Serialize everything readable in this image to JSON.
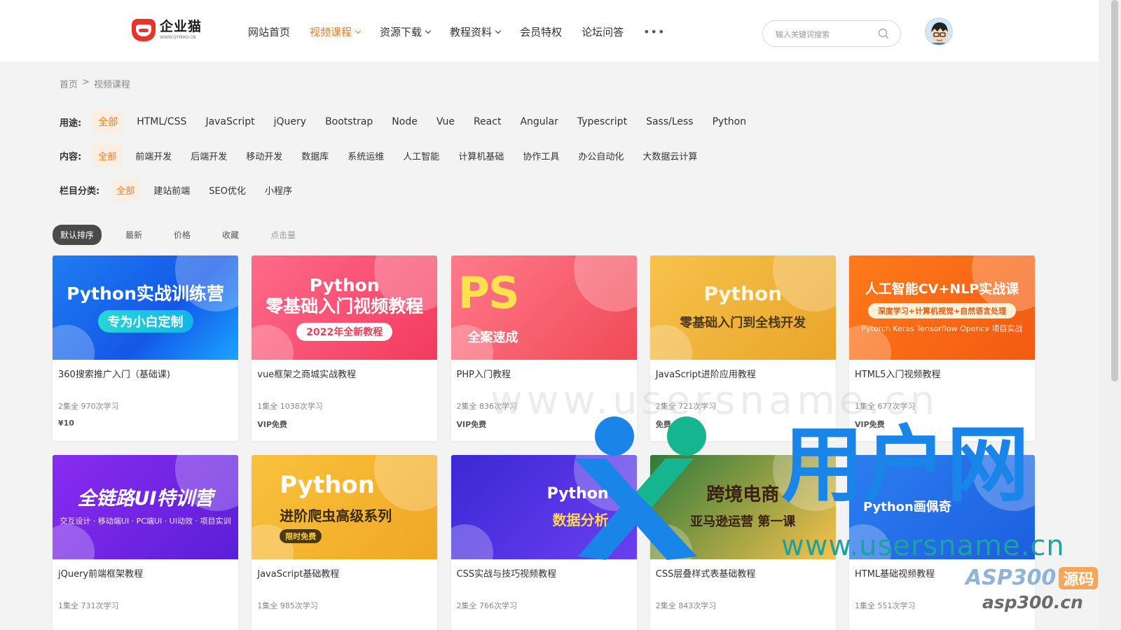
{
  "header": {
    "logo_name": "企业猫",
    "logo_url": "WWW.QYMAO.CN",
    "nav": [
      {
        "label": "网站首页",
        "dropdown": false,
        "active": false
      },
      {
        "label": "视频课程",
        "dropdown": true,
        "active": true
      },
      {
        "label": "资源下载",
        "dropdown": true,
        "active": false
      },
      {
        "label": "教程资料",
        "dropdown": true,
        "active": false
      },
      {
        "label": "会员特权",
        "dropdown": false,
        "active": false
      },
      {
        "label": "论坛问答",
        "dropdown": false,
        "active": false
      }
    ],
    "more": "•••",
    "search_placeholder": "输入关键词搜索"
  },
  "breadcrumb": {
    "home": "首页",
    "sep": ">",
    "current": "视频课程"
  },
  "filters": {
    "usage": {
      "label": "用途:",
      "options": [
        "全部",
        "HTML/CSS",
        "JavaScript",
        "jQuery",
        "Bootstrap",
        "Node",
        "Vue",
        "React",
        "Angular",
        "Typescript",
        "Sass/Less",
        "Python"
      ]
    },
    "content": {
      "label": "内容:",
      "options": [
        "全部",
        "前端开发",
        "后端开发",
        "移动开发",
        "数据库",
        "系统运维",
        "人工智能",
        "计算机基础",
        "协作工具",
        "办公自动化",
        "大数据云计算"
      ]
    },
    "category": {
      "label": "栏目分类:",
      "options": [
        "全部",
        "建站前端",
        "SEO优化",
        "小程序"
      ]
    }
  },
  "sort": [
    "默认排序",
    "最新",
    "价格",
    "收藏",
    "点击量"
  ],
  "cards": [
    {
      "thumb_t1": "Python实战训练营",
      "thumb_t2": "专为小白定制",
      "thumb_t3": "",
      "title": "360搜索推广入门（基础课)",
      "meta": "2集全 970次学习",
      "price": "¥10"
    },
    {
      "thumb_t1": "Python\n零基础入门视频教程",
      "thumb_t2": "2022年全新教程",
      "thumb_t3": "",
      "title": "vue框架之商城实战教程",
      "meta": "1集全 1038次学习",
      "price": "VIP免费"
    },
    {
      "thumb_t1": "PS",
      "thumb_t2": "全案速成",
      "thumb_t3": "",
      "title": "PHP入门教程",
      "meta": "2集全 836次学习",
      "price": "VIP免费"
    },
    {
      "thumb_t1": "Python",
      "thumb_t2": "零基础入门到全栈开发",
      "thumb_t3": "",
      "title": "JavaScript进阶应用教程",
      "meta": "2集全 721次学习",
      "price": "免费"
    },
    {
      "thumb_t1": "人工智能CV+NLP实战课",
      "thumb_t2": "深度学习+计算机视觉+自然语言处理",
      "thumb_t3": "Pytorch Keras Tensorflow Opencv 项目实战",
      "title": "HTML5入门视频教程",
      "meta": "1集全 677次学习",
      "price": "VIP免费"
    },
    {
      "thumb_t1": "全链路UI特训营",
      "thumb_t2": "",
      "thumb_t3": "交互设计 · 移动端UI · PC端UI · UI动效 · 项目实训",
      "title": "jQuery前端框架教程",
      "meta": "1集全 731次学习",
      "price": ""
    },
    {
      "thumb_t1": "Python",
      "thumb_t2": "进阶爬虫高级系列",
      "thumb_t3": "限时免费",
      "title": "JavaScript基础教程",
      "meta": "1集全 985次学习",
      "price": ""
    },
    {
      "thumb_t1": "Python",
      "thumb_t2": "数据分析",
      "thumb_t3": "",
      "title": "CSS实战与技巧视频教程",
      "meta": "2集全 766次学习",
      "price": ""
    },
    {
      "thumb_t1": "跨境电商",
      "thumb_t2": "亚马逊运营 第一课",
      "thumb_t3": "",
      "title": "CSS层叠样式表基础教程",
      "meta": "2集全 843次学习",
      "price": ""
    },
    {
      "thumb_t1": "Python画佩奇",
      "thumb_t2": "",
      "thumb_t3": "",
      "title": "HTML基础视频教程",
      "meta": "1集全 551次学习",
      "price": ""
    }
  ],
  "watermark": {
    "big": "用户网",
    "url": "www.usersname.cn",
    "asp": "ASP300",
    "asp_tag": "源码",
    "asp_url": "asp300.cn"
  }
}
